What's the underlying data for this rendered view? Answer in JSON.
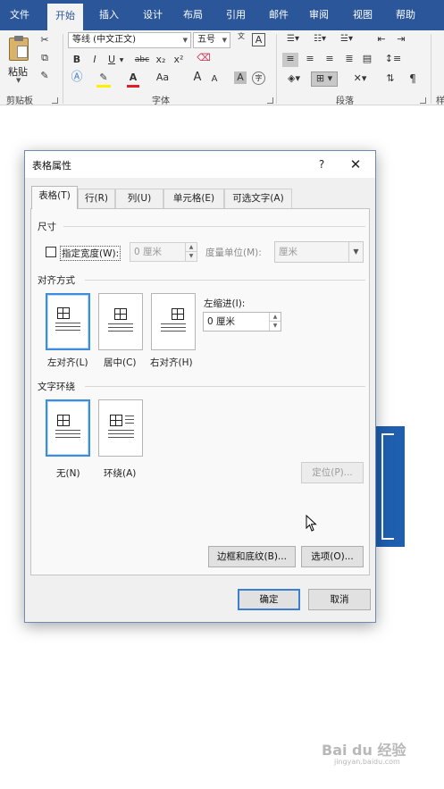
{
  "ribbon": {
    "tabs": [
      "文件",
      "开始",
      "插入",
      "设计",
      "布局",
      "引用",
      "邮件",
      "审阅",
      "视图",
      "帮助"
    ],
    "active_tab": "开始",
    "clipboard": {
      "paste_label": "粘贴",
      "group_label": "剪贴板"
    },
    "font": {
      "name": "等线 (中文正文)",
      "size": "五号",
      "wen_icon": "文",
      "a_box": "A",
      "bold": "B",
      "italic": "I",
      "underline": "U",
      "strike": "abc",
      "sub": "x₂",
      "sup": "x²",
      "grow": "A",
      "shrink": "A",
      "case": "Aa",
      "group_label": "字体",
      "char_shade": "A",
      "enclose": "字"
    },
    "paragraph": {
      "group_label": "段落"
    },
    "styles": {
      "group_label_partial": "样"
    }
  },
  "dialog": {
    "title": "表格属性",
    "help": "?",
    "close": "✕",
    "tabs": [
      "表格(T)",
      "行(R)",
      "列(U)",
      "单元格(E)",
      "可选文字(A)"
    ],
    "active_tab": "表格(T)",
    "size": {
      "title": "尺寸",
      "specify_width": "指定宽度(W):",
      "width_value": "0 厘米",
      "unit_label": "度量单位(M):",
      "unit_value": "厘米"
    },
    "alignment": {
      "title": "对齐方式",
      "options": [
        "左对齐(L)",
        "居中(C)",
        "右对齐(H)"
      ],
      "selected": "左对齐(L)",
      "indent_label": "左缩进(I):",
      "indent_value": "0 厘米"
    },
    "wrapping": {
      "title": "文字环绕",
      "options": [
        "无(N)",
        "环绕(A)"
      ],
      "selected": "无(N)",
      "position_button": "定位(P)..."
    },
    "borders_button": "边框和底纹(B)...",
    "options_button": "选项(O)...",
    "ok_button": "确定",
    "cancel_button": "取消"
  },
  "watermark": {
    "logo": "Bai du 经验",
    "sub": "jingyan.baidu.com"
  },
  "colors": {
    "ribbon_blue": "#2b579a",
    "selection_blue": "#3e8ddd",
    "table_blue": "#1f5fb0"
  }
}
